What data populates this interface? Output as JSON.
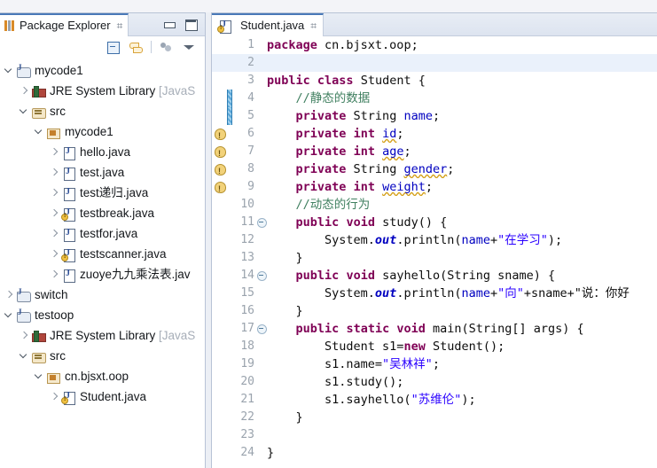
{
  "explorer": {
    "tab_label": "Package Explorer",
    "tab_icon": "package-explorer-icon",
    "close_icon": "⌗",
    "minimize_icon": "minimize-icon",
    "maximize_icon": "maximize-icon",
    "toolbar": {
      "collapse_all": "Collapse All",
      "link_with_editor": "Link with Editor",
      "view_menu": "View Menu"
    },
    "tree": [
      {
        "label": "mycode1",
        "suffix": "",
        "indent": 0,
        "twisty": "down",
        "icon": "project-icon",
        "warn": false
      },
      {
        "label": "JRE System Library",
        "suffix": " [JavaS",
        "indent": 1,
        "twisty": "right",
        "icon": "jre-icon",
        "warn": false
      },
      {
        "label": "src",
        "suffix": "",
        "indent": 1,
        "twisty": "down",
        "icon": "src-folder-icon",
        "warn": false
      },
      {
        "label": "mycode1",
        "suffix": "",
        "indent": 2,
        "twisty": "down",
        "icon": "package-icon",
        "warn": false
      },
      {
        "label": "hello.java",
        "suffix": "",
        "indent": 3,
        "twisty": "right",
        "icon": "java-file-icon",
        "warn": false
      },
      {
        "label": "test.java",
        "suffix": "",
        "indent": 3,
        "twisty": "right",
        "icon": "java-file-icon",
        "warn": false
      },
      {
        "label": "test递归.java",
        "suffix": "",
        "indent": 3,
        "twisty": "right",
        "icon": "java-file-icon",
        "warn": false
      },
      {
        "label": "testbreak.java",
        "suffix": "",
        "indent": 3,
        "twisty": "right",
        "icon": "java-file-icon",
        "warn": true
      },
      {
        "label": "testfor.java",
        "suffix": "",
        "indent": 3,
        "twisty": "right",
        "icon": "java-file-icon",
        "warn": false
      },
      {
        "label": "testscanner.java",
        "suffix": "",
        "indent": 3,
        "twisty": "right",
        "icon": "java-file-icon",
        "warn": true
      },
      {
        "label": "zuoye九九乘法表.jav",
        "suffix": "",
        "indent": 3,
        "twisty": "right",
        "icon": "java-file-icon",
        "warn": false
      },
      {
        "label": "switch",
        "suffix": "",
        "indent": 0,
        "twisty": "right",
        "icon": "project-icon",
        "warn": false
      },
      {
        "label": "testoop",
        "suffix": "",
        "indent": 0,
        "twisty": "down",
        "icon": "project-icon",
        "warn": false
      },
      {
        "label": "JRE System Library",
        "suffix": " [JavaS",
        "indent": 1,
        "twisty": "right",
        "icon": "jre-icon",
        "warn": false
      },
      {
        "label": "src",
        "suffix": "",
        "indent": 1,
        "twisty": "down",
        "icon": "src-folder-icon",
        "warn": false
      },
      {
        "label": "cn.bjsxt.oop",
        "suffix": "",
        "indent": 2,
        "twisty": "down",
        "icon": "package-icon",
        "warn": false
      },
      {
        "label": "Student.java",
        "suffix": "",
        "indent": 3,
        "twisty": "right",
        "icon": "java-file-icon",
        "warn": true
      }
    ]
  },
  "editor": {
    "tab_label": "Student.java",
    "tab_icon": "java-file-icon",
    "close_icon": "⌗",
    "lines": [
      {
        "n": "1",
        "fold": false,
        "warn": false,
        "changed": false,
        "cur": false
      },
      {
        "n": "2",
        "fold": false,
        "warn": false,
        "changed": false,
        "cur": true
      },
      {
        "n": "3",
        "fold": false,
        "warn": false,
        "changed": false,
        "cur": false
      },
      {
        "n": "4",
        "fold": false,
        "warn": false,
        "changed": true,
        "cur": false
      },
      {
        "n": "5",
        "fold": false,
        "warn": false,
        "changed": true,
        "cur": false
      },
      {
        "n": "6",
        "fold": false,
        "warn": true,
        "changed": false,
        "cur": false
      },
      {
        "n": "7",
        "fold": false,
        "warn": true,
        "changed": false,
        "cur": false
      },
      {
        "n": "8",
        "fold": false,
        "warn": true,
        "changed": false,
        "cur": false
      },
      {
        "n": "9",
        "fold": false,
        "warn": true,
        "changed": false,
        "cur": false
      },
      {
        "n": "10",
        "fold": false,
        "warn": false,
        "changed": false,
        "cur": false
      },
      {
        "n": "11",
        "fold": true,
        "warn": false,
        "changed": false,
        "cur": false
      },
      {
        "n": "12",
        "fold": false,
        "warn": false,
        "changed": false,
        "cur": false
      },
      {
        "n": "13",
        "fold": false,
        "warn": false,
        "changed": false,
        "cur": false
      },
      {
        "n": "14",
        "fold": true,
        "warn": false,
        "changed": false,
        "cur": false
      },
      {
        "n": "15",
        "fold": false,
        "warn": false,
        "changed": false,
        "cur": false
      },
      {
        "n": "16",
        "fold": false,
        "warn": false,
        "changed": false,
        "cur": false
      },
      {
        "n": "17",
        "fold": true,
        "warn": false,
        "changed": false,
        "cur": false
      },
      {
        "n": "18",
        "fold": false,
        "warn": false,
        "changed": false,
        "cur": false
      },
      {
        "n": "19",
        "fold": false,
        "warn": false,
        "changed": false,
        "cur": false
      },
      {
        "n": "20",
        "fold": false,
        "warn": false,
        "changed": false,
        "cur": false
      },
      {
        "n": "21",
        "fold": false,
        "warn": false,
        "changed": false,
        "cur": false
      },
      {
        "n": "22",
        "fold": false,
        "warn": false,
        "changed": false,
        "cur": false
      },
      {
        "n": "23",
        "fold": false,
        "warn": false,
        "changed": false,
        "cur": false
      },
      {
        "n": "24",
        "fold": false,
        "warn": false,
        "changed": false,
        "cur": false
      }
    ],
    "source_text": [
      "package cn.bjsxt.oop;",
      "",
      "public class Student {",
      "    //静态的数据",
      "    private String name;",
      "    private int id;",
      "    private int age;",
      "    private String gender;",
      "    private int weight;",
      "    //动态的行为",
      "    public void study() {",
      "        System.out.println(name+\"在学习\");",
      "    }",
      "    public void sayhello(String sname) {",
      "        System.out.println(name+\"向\"+sname+\"说：你好",
      "    }",
      "    public static void main(String[] args) {",
      "        Student s1=new Student();",
      "        s1.name=\"吴林祥\";",
      "        s1.study();",
      "        s1.sayhello(\"苏维伦\");",
      "    }",
      "",
      "}"
    ]
  },
  "colors": {
    "keyword": "#7f0055",
    "string": "#2a00ff",
    "comment": "#3f7f5f",
    "field": "#0000c0",
    "tab_active_border": "#4a79b8",
    "current_line": "#eaf1fb",
    "warning": "#d4a017"
  }
}
